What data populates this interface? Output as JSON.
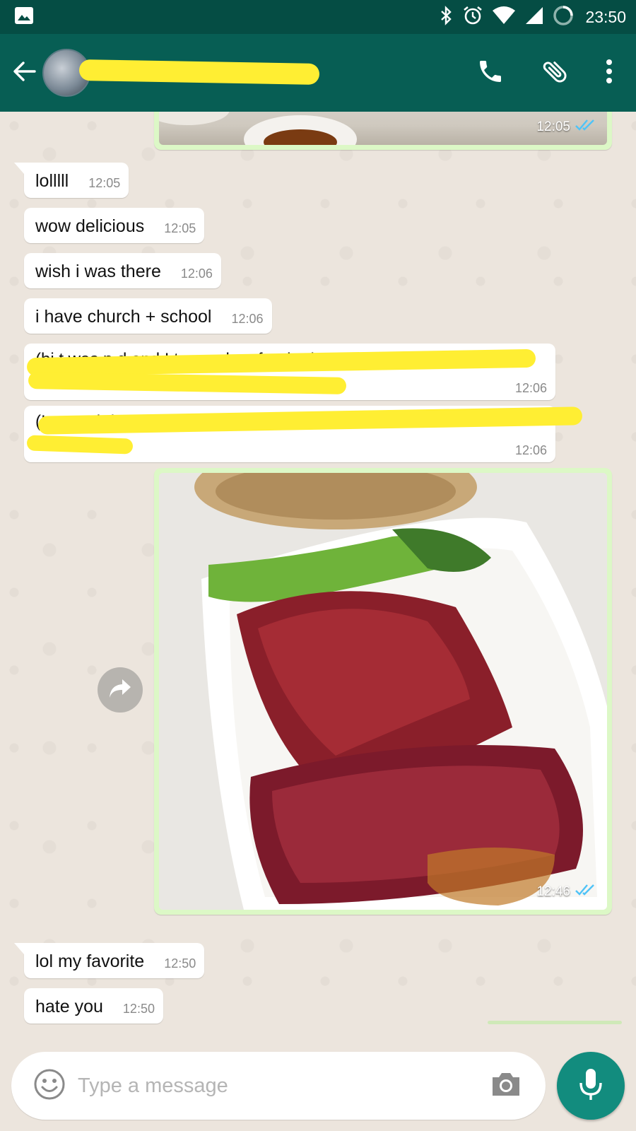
{
  "status_bar": {
    "time": "23:50",
    "icons": [
      "image-icon",
      "bluetooth-icon",
      "alarm-icon",
      "wifi-icon",
      "signal-icon",
      "battery-icon"
    ]
  },
  "app_bar": {
    "contact_name": "",
    "icons": [
      "back-arrow-icon",
      "phone-icon",
      "paperclip-icon",
      "more-vert-icon"
    ],
    "bg_color": "#075e54"
  },
  "messages": [
    {
      "type": "image_out",
      "time": "12:05",
      "status": "read"
    },
    {
      "type": "text_in",
      "text": "lolllll",
      "time": "12:05"
    },
    {
      "type": "text_in",
      "text": "wow delicious",
      "time": "12:05"
    },
    {
      "type": "text_in",
      "text": "wish i was there",
      "time": "12:06"
    },
    {
      "type": "text_in",
      "text": "i have church + school",
      "time": "12:06"
    },
    {
      "type": "text_in_redacted",
      "text": "(bi  t  was     p  d and  I      two orders  for the it      come in 2 pa         e)",
      "time": "12:06"
    },
    {
      "type": "text_in_redacted",
      "text": "(I      we      g                  d      dn't   t  h    t  down",
      "time": "12:06"
    },
    {
      "type": "image_out",
      "time": "12:46",
      "status": "read"
    },
    {
      "type": "text_in",
      "text": "lol my favorite",
      "time": "12:50"
    },
    {
      "type": "text_in",
      "text": "hate you",
      "time": "12:50"
    }
  ],
  "input": {
    "placeholder": "Type a message",
    "value": ""
  },
  "colors": {
    "accent": "#128c7e",
    "outgoing_bubble": "#dcf8c6",
    "incoming_bubble": "#ffffff",
    "read_tick": "#4fc3f7",
    "redaction": "#ffee33"
  }
}
